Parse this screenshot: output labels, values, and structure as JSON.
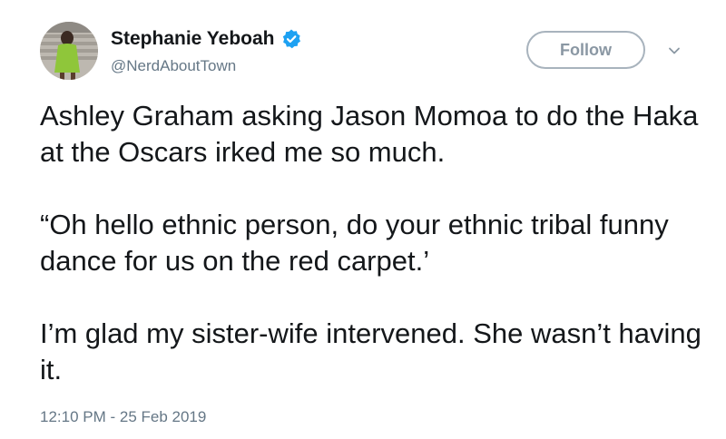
{
  "user": {
    "display_name": "Stephanie Yeboah",
    "handle": "@NerdAboutTown",
    "verified_icon": "verified-badge-icon",
    "avatar_icon": "avatar"
  },
  "actions": {
    "follow_label": "Follow",
    "menu_icon": "chevron-down-icon"
  },
  "tweet": {
    "paragraphs": [
      "Ashley Graham asking Jason Momoa to do the Haka at the Oscars irked me so much.",
      "“Oh hello ethnic person, do your ethnic tribal funny dance for us on the red carpet.’",
      "I’m glad my sister-wife intervened. She wasn’t having it."
    ],
    "timestamp": "12:10 PM - 25 Feb 2019"
  },
  "colors": {
    "text": "#14171a",
    "secondary": "#657786",
    "verified": "#1da1f2",
    "follow_border": "#a8b3bd"
  }
}
